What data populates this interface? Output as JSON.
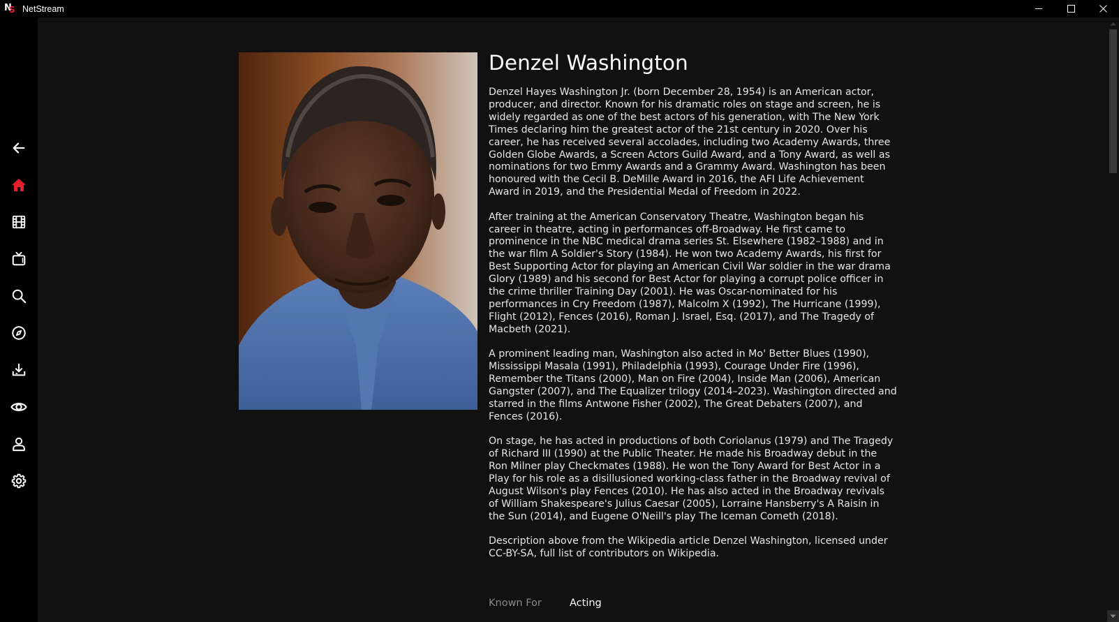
{
  "window": {
    "app_title": "NetStream",
    "logo_letters": "NS",
    "controls": [
      "minimize-icon",
      "maximize-icon",
      "close-icon"
    ]
  },
  "sidebar": {
    "items": [
      {
        "name": "back",
        "icon": "arrow-left-icon"
      },
      {
        "name": "home",
        "icon": "home-icon",
        "active": true
      },
      {
        "name": "movies",
        "icon": "film-icon"
      },
      {
        "name": "tv",
        "icon": "tv-icon"
      },
      {
        "name": "search",
        "icon": "search-icon"
      },
      {
        "name": "discover",
        "icon": "compass-icon"
      },
      {
        "name": "downloads",
        "icon": "download-icon"
      },
      {
        "name": "watchlist",
        "icon": "eye-icon"
      },
      {
        "name": "profile",
        "icon": "person-icon"
      },
      {
        "name": "settings",
        "icon": "gear-icon"
      }
    ],
    "active_color": "#e5202a"
  },
  "person": {
    "name": "Denzel Washington",
    "bio": [
      "Denzel Hayes Washington Jr. (born December 28, 1954) is an American actor, producer, and director. Known for his dramatic roles on stage and screen, he is widely regarded as one of the best actors of his generation, with The New York Times declaring him the greatest actor of the 21st century in 2020. Over his career, he has received several accolades, including two Academy Awards, three Golden Globe Awards, a Screen Actors Guild Award, and a Tony Award, as well as nominations for two Emmy Awards and a Grammy Award. Washington has been honoured with the Cecil B. DeMille Award in 2016, the AFI Life Achievement Award in 2019, and the Presidential Medal of Freedom in 2022.",
      "After training at the American Conservatory Theatre, Washington began his career in theatre, acting in performances off-Broadway. He first came to prominence in the NBC medical drama series St. Elsewhere (1982–1988) and in the war film A Soldier's Story (1984). He won two Academy Awards, his first for Best Supporting Actor for playing an American Civil War soldier in the war drama Glory (1989) and his second for Best Actor for playing a corrupt police officer in the crime thriller Training Day (2001). He was Oscar-nominated for his performances in Cry Freedom (1987), Malcolm X (1992), The Hurricane (1999), Flight (2012), Fences (2016), Roman J. Israel, Esq. (2017), and The Tragedy of Macbeth (2021).",
      "A prominent leading man, Washington also acted in Mo' Better Blues (1990), Mississippi Masala (1991), Philadelphia (1993), Courage Under Fire (1996), Remember the Titans (2000), Man on Fire (2004), Inside Man (2006), American Gangster (2007), and The Equalizer trilogy (2014–2023). Washington directed and starred in the films Antwone Fisher (2002), The Great Debaters (2007), and Fences (2016).",
      "On stage, he has acted in productions of both Coriolanus (1979) and The Tragedy of Richard III (1990) at the Public Theater. He made his Broadway debut in the Ron Milner play Checkmates (1988). He won the Tony Award for Best Actor in a Play for his role as a disillusioned working-class father in the Broadway revival of August Wilson's play Fences (2010). He has also acted in the Broadway revivals of William Shakespeare's Julius Caesar (2005), Lorraine Hansberry's A Raisin in the Sun (2014), and Eugene O'Neill's play The Iceman Cometh (2018).",
      "Description above from the Wikipedia article Denzel Washington, licensed under CC-BY-SA, full list of contributors on Wikipedia."
    ],
    "known_for_label": "Known For",
    "known_for_value": "Acting"
  }
}
